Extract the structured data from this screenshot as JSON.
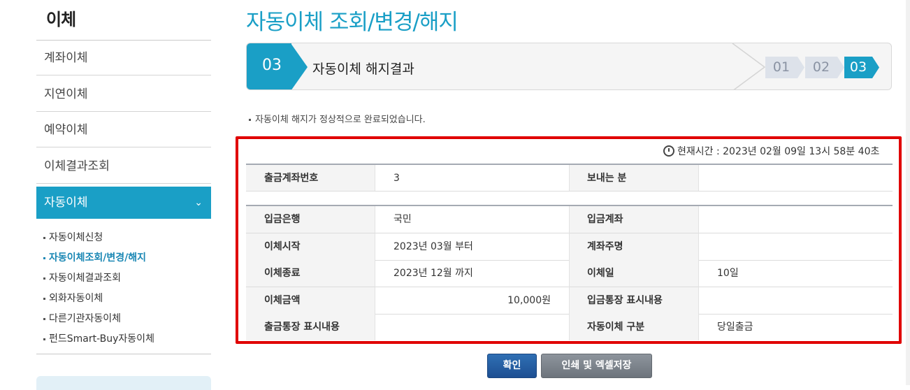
{
  "sidebar": {
    "title": "이체",
    "menu": [
      {
        "label": "계좌이체"
      },
      {
        "label": "지연이체"
      },
      {
        "label": "예약이체"
      },
      {
        "label": "이체결과조회"
      },
      {
        "label": "자동이체"
      }
    ],
    "submenu": [
      {
        "label": "자동이체신청"
      },
      {
        "label": "자동이체조회/변경/해지"
      },
      {
        "label": "자동이체결과조회"
      },
      {
        "label": "외화자동이체"
      },
      {
        "label": "다른기관자동이체"
      },
      {
        "label": "펀드Smart-Buy자동이체"
      }
    ]
  },
  "main": {
    "title": "자동이체 조회/변경/해지",
    "step": {
      "current_number": "03",
      "current_name": "자동이체 해지결과",
      "indicators": [
        "01",
        "02",
        "03"
      ]
    },
    "notice": "자동이체 해지가 정상적으로 완료되었습니다.",
    "current_time": "현재시간 : 2023년 02월 09일 13시 58분 40초",
    "table": {
      "withdraw_account_label": "출금계좌번호",
      "withdraw_account_value": "3",
      "sender_label": "보내는 분",
      "sender_value": "",
      "deposit_bank_label": "입금은행",
      "deposit_bank_value": "국민",
      "deposit_account_label": "입금계좌",
      "deposit_account_value": "",
      "start_label": "이체시작",
      "start_value": "2023년 03월 부터",
      "account_holder_label": "계좌주명",
      "account_holder_value": "",
      "end_label": "이체종료",
      "end_value": "2023년 12월 까지",
      "transfer_day_label": "이체일",
      "transfer_day_value": "10일",
      "amount_label": "이체금액",
      "amount_value": "10,000원",
      "deposit_memo_label": "입금통장 표시내용",
      "deposit_memo_value": "",
      "withdraw_memo_label": "출금통장 표시내용",
      "withdraw_memo_value": "",
      "type_label": "자동이체 구분",
      "type_value": "당일출금"
    },
    "buttons": {
      "confirm": "확인",
      "print": "인쇄 및 엑셀저장"
    }
  },
  "colors": {
    "accent": "#1a9fc6",
    "highlight": "#e00000",
    "primary_button": "#245d9f",
    "secondary_button": "#7a8189"
  },
  "icons": {
    "clock": "clock-icon",
    "chevron": "chevron-down-icon"
  }
}
